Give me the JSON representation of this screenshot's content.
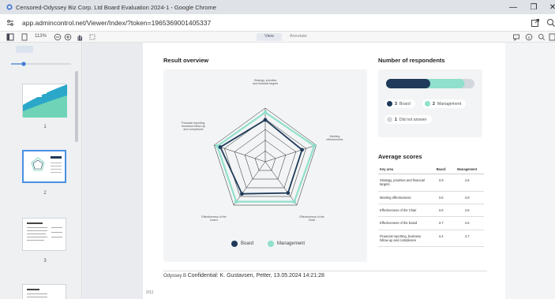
{
  "window": {
    "title": "Censored-Odyssey Biz Corp. Ltd Board Evaluation 2024-1 - Google Chrome",
    "minimize": "—",
    "maximize": "❐",
    "close": "✕"
  },
  "browser": {
    "url": "app.admincontrol.net/Viewer/Index/?token=1965369001405337"
  },
  "pdf_toolbar": {
    "zoom": "113%",
    "view_label": "View",
    "annotate_label": "Annotate"
  },
  "sidebar": {
    "page_numbers": [
      "1",
      "2",
      "3"
    ]
  },
  "result_overview": {
    "title": "Result overview",
    "axes": [
      "Strategy, priorities and financial targets",
      "Meeting effectiveness",
      "Effectiveness of the Chair",
      "Effectiveness of the board",
      "Financial reporting, business follow-up and compliance"
    ],
    "legend": [
      {
        "name": "Board",
        "color": "#1f3a5a"
      },
      {
        "name": "Management",
        "color": "#8fe0cc"
      }
    ]
  },
  "chart_data": {
    "type": "radar",
    "categories": [
      "Strategy, priorities and financial targets",
      "Meeting effectiveness",
      "Effectiveness of the Chair",
      "Effectiveness of the board",
      "Financial reporting, business follow-up and compliance"
    ],
    "series": [
      {
        "name": "Board",
        "values": [
          3.9,
          3.6,
          3.6,
          3.7,
          4.4
        ]
      },
      {
        "name": "Management",
        "values": [
          4.6,
          4.8,
          4.6,
          4.6,
          4.7
        ]
      }
    ],
    "range": [
      0,
      5
    ],
    "grid": true,
    "legend": "bottom"
  },
  "respondents": {
    "title": "Number of respondents",
    "bar": {
      "board": 3,
      "management": 2,
      "not_answered": 1
    },
    "items": [
      {
        "count": "3",
        "label": "Board",
        "color": "#1f3a5a"
      },
      {
        "count": "2",
        "label": "Management",
        "color": "#8fe0cc"
      },
      {
        "count": "1",
        "label": "Did not answer",
        "color": "#d3d8de"
      }
    ]
  },
  "average_scores": {
    "title": "Average scores",
    "headers": [
      "Key area",
      "Board",
      "Management"
    ],
    "rows": [
      [
        "Strategy, priorities and financial targets",
        "3.9",
        "4.6"
      ],
      [
        "Meeting effectiveness",
        "3.6",
        "4.8"
      ],
      [
        "Effectiveness of the Chair",
        "3.6",
        "4.6"
      ],
      [
        "Effectiveness of the board",
        "3.7",
        "4.6"
      ],
      [
        "Financial reporting, business follow-up and compliance",
        "4.4",
        "4.7"
      ]
    ]
  },
  "footer": {
    "org": "Odyssey B",
    "confidential": "Confidential: K. Gustavsen, Petter, 13.05.2024 14:21:28",
    "page_count": "2/11"
  }
}
